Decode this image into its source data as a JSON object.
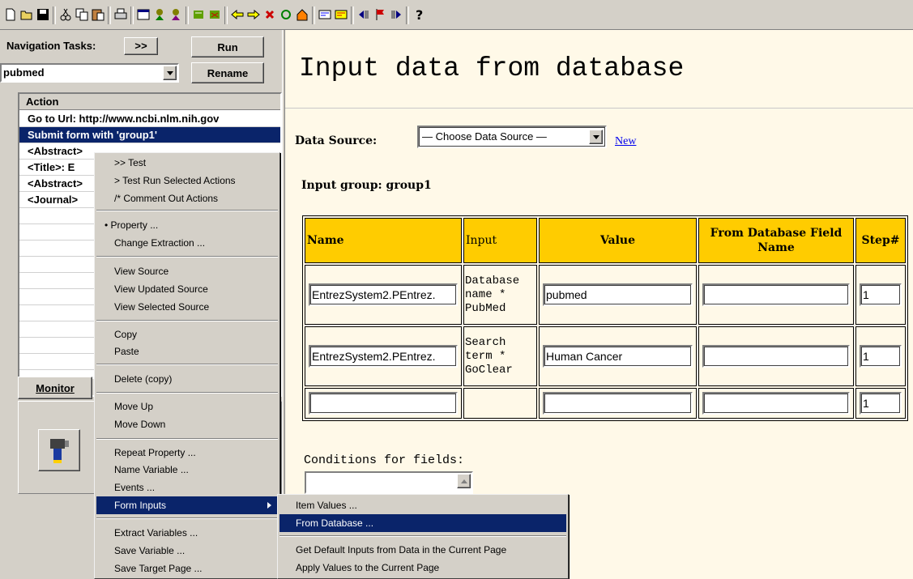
{
  "toolbar": {
    "icons": [
      "new-icon",
      "open-icon",
      "save-icon",
      "cut-icon",
      "copy-icon",
      "paste-icon",
      "print-icon",
      "window-icon",
      "run-agent-icon",
      "step-agent-icon",
      "record-icon",
      "record-stop-icon",
      "back-icon",
      "forward-icon",
      "stop-icon",
      "refresh-icon",
      "home-icon",
      "extract-icon",
      "extract-all-icon",
      "nav-left-icon",
      "flag-icon",
      "nav-right-icon",
      "help-icon"
    ]
  },
  "left": {
    "nav_tasks_label": "Navigation Tasks:",
    "expand_label": ">>",
    "run_label": "Run",
    "rename_label": "Rename",
    "task_value": "pubmed",
    "action_header": "Action",
    "actions": [
      "Go to Url: http://www.ncbi.nlm.nih.gov",
      "Submit form with 'group1'",
      "<Abstract>",
      "<Title>: E",
      "<Abstract>",
      "<Journal>"
    ],
    "monitor_label": "Monitor"
  },
  "main": {
    "title": "Input data from database",
    "data_source_label": "Data Source:",
    "data_source_value": "— Choose Data Source —",
    "new_link": "New",
    "group_label": "Input group: group1",
    "columns": [
      "Name",
      "Input",
      "Value",
      "From Database Field Name",
      "Step#"
    ],
    "rows": [
      {
        "name": "EntrezSystem2.PEntrez.",
        "input": "Database name * PubMed",
        "value": "pubmed",
        "field": "",
        "step": "1"
      },
      {
        "name": "EntrezSystem2.PEntrez.",
        "input": "Search term * GoClear",
        "value": "Human Cancer",
        "field": "",
        "step": "1"
      },
      {
        "name": "",
        "input": "",
        "value": "",
        "field": "",
        "step": "1"
      }
    ],
    "conditions_label": "Conditions for fields:"
  },
  "context_menu": {
    "items": [
      ">> Test",
      "> Test Run Selected Actions",
      "/* Comment Out Actions",
      "• Property ...",
      "Change Extraction ...",
      "View Source",
      "View Updated Source",
      "View Selected Source",
      "Copy",
      "Paste",
      "Delete (copy)",
      "Move Up",
      "Move Down",
      "Repeat Property ...",
      "Name Variable ...",
      "Events ...",
      "Form Inputs",
      "Extract Variables ...",
      "Save Variable ...",
      "Save Target Page ..."
    ]
  },
  "submenu": {
    "items": [
      "Item Values ...",
      "From Database ...",
      "Get Default Inputs from Data in the Current Page",
      "Apply Values to the Current Page"
    ]
  },
  "colors": {
    "highlight": "#0a246a",
    "header_bg": "#ffcc00",
    "main_bg": "#fff9e8",
    "chrome": "#d4d0c8"
  }
}
